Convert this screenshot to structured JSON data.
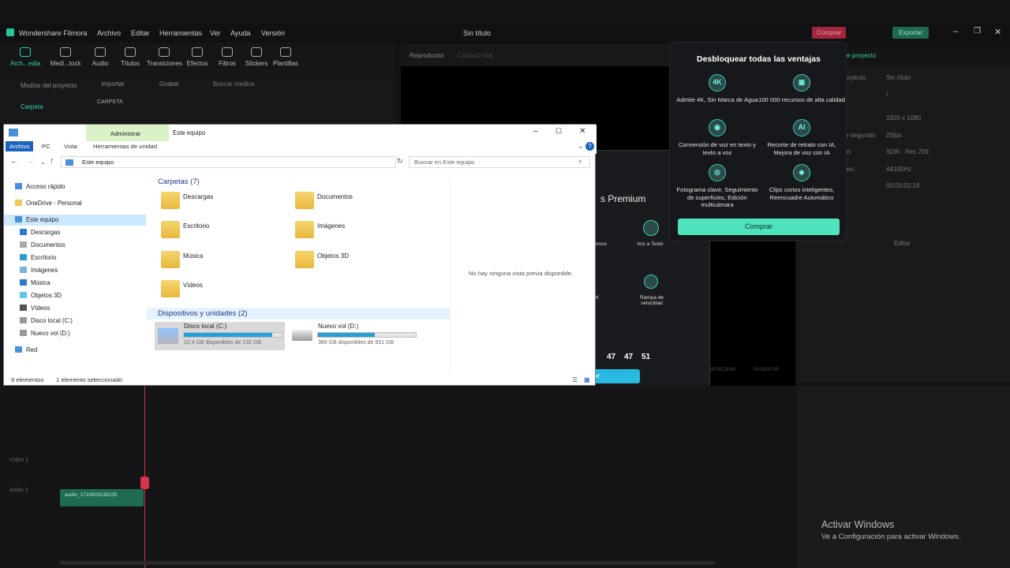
{
  "filmora": {
    "app_name": "Wondershare Filmora",
    "menu": [
      "Archivo",
      "Editar",
      "Herramientas",
      "Ver",
      "Ayuda",
      "Versión"
    ],
    "project_title": "Sin título",
    "buy_label": "Comprar",
    "export_label": "Exportar",
    "tools": [
      "Arch...edia",
      "Medi...tock",
      "Audio",
      "Títulos",
      "Transiciones",
      "Efectos",
      "Filtros",
      "Stickers",
      "Plantillas"
    ],
    "project_media": "Medios del proyecto",
    "import": "Importar",
    "record": "Grabar",
    "search_media": "Buscar medios",
    "folder": "Carpeta",
    "folder_header": "CARPETA",
    "player": "Reproductor",
    "quality": "Calidad total",
    "props": {
      "project_label": "e proyecto",
      "name_label": "oyecto:",
      "name": "Sin título",
      "res": "1920 x 1080",
      "fps_label": "r segundo:",
      "fps": "25fps",
      "color_label": "n:",
      "color": "SDR - Rec.709",
      "audio_label": "eo:",
      "audio": "44100Hz",
      "duration": "00:00:02:18",
      "slash": "/",
      "edit": "Editar"
    },
    "video_track": "Vídeo 1",
    "audio_track": "Audio 1",
    "clip_name": "audio_1733603239235",
    "timeline_ticks": [
      "00:00:23:00",
      "00:00:22:00"
    ]
  },
  "premium": {
    "title": "s Premium",
    "voice": "Voz a Texto",
    "recursos": "ursos",
    "speed": "Rampa de velocidad",
    "k": "K",
    "timer": [
      "47",
      "47",
      "51"
    ],
    "btn": "ar"
  },
  "upsell": {
    "title": "Desbloquear todas las ventajas",
    "features": [
      {
        "icon": "4K",
        "text": "Admite 4K, Sin Marca de Agua"
      },
      {
        "icon": "▣",
        "text": "100 000 recursos de alta calidad"
      },
      {
        "icon": "◉",
        "text": "Conversión de voz en texto y texto a voz"
      },
      {
        "icon": "AI",
        "text": "Recorte de retrato con IA, Mejora de voz con IA"
      },
      {
        "icon": "◎",
        "text": "Fotograma clave, Seguimiento de superficies, Edición multicámara"
      },
      {
        "icon": "◆",
        "text": "Clips cortos inteligentes, Reencuadre Automático"
      }
    ],
    "buy": "Comprar"
  },
  "explorer": {
    "manage_tab": "Administrar",
    "window_title": "Este equipo",
    "tabs": [
      "Archivo",
      "PC",
      "Vista",
      "Herramientas de unidad"
    ],
    "address": "Este equipo",
    "search_placeholder": "Buscar en Este equipo",
    "nav": [
      "Acceso rápido",
      "OneDrive - Personal",
      "Este equipo",
      "Descargas",
      "Documentos",
      "Escritorio",
      "Imágenes",
      "Música",
      "Objetos 3D",
      "Vídeos",
      "Disco local (C:)",
      "Nuevo vol (D:)",
      "Red"
    ],
    "folders_header": "Carpetas (7)",
    "folders": [
      "Descargas",
      "Documentos",
      "Escritorio",
      "Imágenes",
      "Música",
      "Objetos 3D",
      "Vídeos"
    ],
    "devices_header": "Dispositivos y unidades (2)",
    "drives": [
      {
        "name": "Disco local (C:)",
        "free": "22,4 GB disponibles de 232 GB",
        "used_fraction": 0.9
      },
      {
        "name": "Nuevo vol (D:)",
        "free": "389 GB disponibles de 931 GB",
        "used_fraction": 0.58
      }
    ],
    "preview_text": "No hay ninguna vista previa disponible.",
    "status_count": "9 elementos",
    "status_selected": "1 elemento seleccionado"
  },
  "windows": {
    "title": "Activar Windows",
    "subtitle": "Ve a Configuración para activar Windows."
  }
}
